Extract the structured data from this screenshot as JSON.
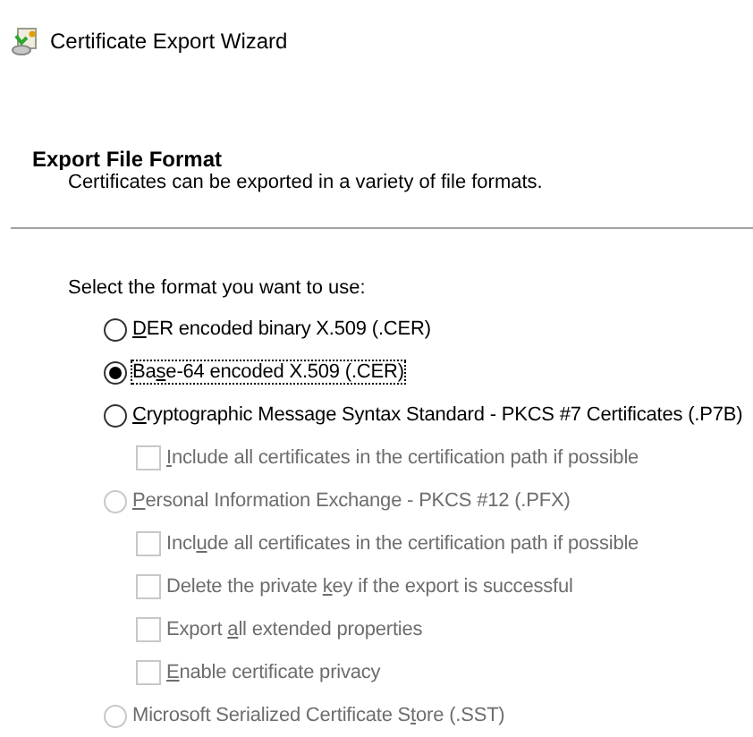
{
  "window": {
    "title": "Certificate Export Wizard"
  },
  "header": {
    "title": "Export File Format",
    "subtitle": "Certificates can be exported in a variety of file formats."
  },
  "prompt": "Select the format you want to use:",
  "options": [
    {
      "kind": "radio",
      "access_key": "D",
      "label_end": "ER encoded binary X.509 (.CER)",
      "selected": false,
      "disabled": false,
      "focused": false
    },
    {
      "kind": "radio",
      "label_start": "Ba",
      "access_key": "s",
      "label_end": "e-64 encoded X.509 (.CER)",
      "selected": true,
      "disabled": false,
      "focused": true
    },
    {
      "kind": "radio",
      "access_key": "C",
      "label_end": "ryptographic Message Syntax Standard - PKCS #7 Certificates (.P7B)",
      "selected": false,
      "disabled": false,
      "focused": false
    },
    {
      "kind": "checkbox",
      "access_key": "I",
      "label_end": "nclude all certificates in the certification path if possible",
      "checked": false,
      "disabled": true
    },
    {
      "kind": "radio",
      "access_key": "P",
      "label_end": "ersonal Information Exchange - PKCS #12 (.PFX)",
      "selected": false,
      "disabled": true,
      "focused": false
    },
    {
      "kind": "checkbox",
      "label_start": "Incl",
      "access_key": "u",
      "label_end": "de all certificates in the certification path if possible",
      "checked": false,
      "disabled": true
    },
    {
      "kind": "checkbox",
      "label_start": "Delete the private ",
      "access_key": "k",
      "label_end": "ey if the export is successful",
      "checked": false,
      "disabled": true
    },
    {
      "kind": "checkbox",
      "label_start": "Export ",
      "access_key": "a",
      "label_end": "ll extended properties",
      "checked": false,
      "disabled": true
    },
    {
      "kind": "checkbox",
      "access_key": "E",
      "label_end": "nable certificate privacy",
      "checked": false,
      "disabled": true
    },
    {
      "kind": "radio",
      "label_start": "Microsoft Serialized Certificate S",
      "access_key": "t",
      "label_end": "ore (.SST)",
      "selected": false,
      "disabled": true,
      "focused": false
    }
  ]
}
